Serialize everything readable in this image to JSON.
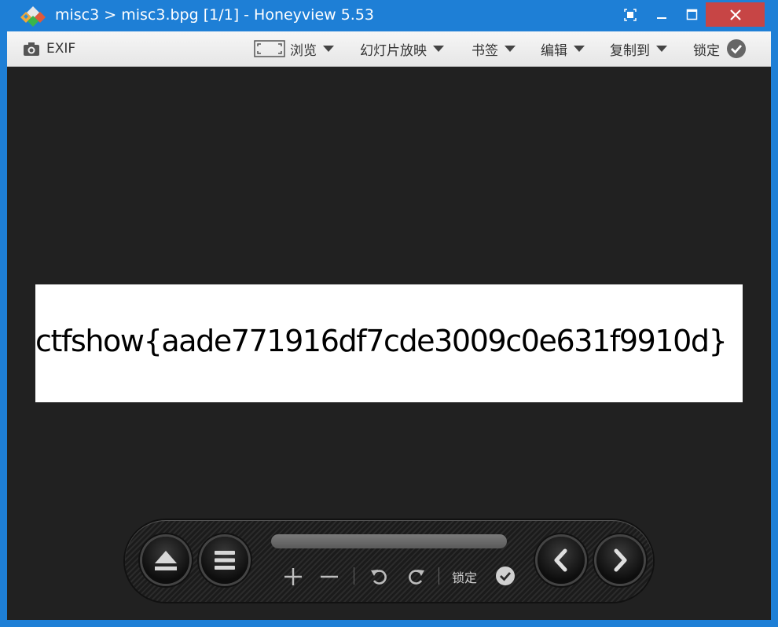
{
  "window": {
    "title": "misc3 > misc3.bpg [1/1] - Honeyview 5.53"
  },
  "toolbar": {
    "exif_label": "EXIF",
    "browse_label": "浏览",
    "slideshow_label": "幻灯片放映",
    "bookmark_label": "书签",
    "edit_label": "编辑",
    "copy_to_label": "复制到",
    "lock_label": "锁定"
  },
  "image": {
    "text": "ctfshow{aade771916df7cde3009c0e631f9910d}"
  },
  "controls": {
    "lock_label": "锁定"
  },
  "colors": {
    "titlebar": "#1e7fd6",
    "close_button": "#c74545",
    "viewer_bg": "#212121"
  }
}
